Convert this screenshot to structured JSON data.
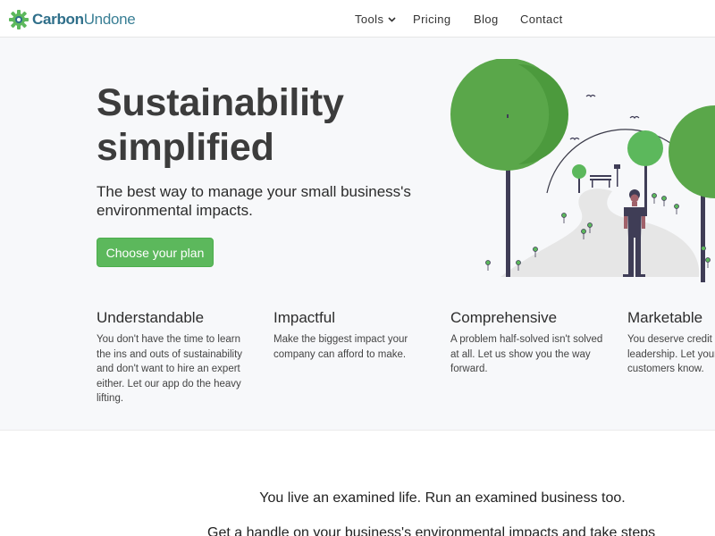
{
  "brand": {
    "name_part1": "Carbon",
    "name_part2": "Undone",
    "logo_icon": "gear-icon",
    "color_primary": "#2f6f8a",
    "color_gear": "#5cb85c"
  },
  "nav": {
    "tools": "Tools",
    "tools_icon": "chevron-down-icon",
    "pricing": "Pricing",
    "blog": "Blog",
    "contact": "Contact"
  },
  "hero": {
    "title_line1": "Sustainability",
    "title_line2": "simplified",
    "subtitle": "The best way to manage your small business's environmental impacts.",
    "cta_label": "Choose your plan",
    "cta_color": "#5cb85c"
  },
  "features": [
    {
      "title": "Understandable",
      "text": "You don't have the time to learn the ins and outs of sustainability and don't want to hire an expert either. Let our app do the heavy lifting."
    },
    {
      "title": "Impactful",
      "text": "Make the biggest impact your company can afford to make."
    },
    {
      "title": "Comprehensive",
      "text": "A problem half-solved isn't solved at all. Let us show you the way forward."
    },
    {
      "title": "Marketable",
      "text": "You deserve credit for your leadership. Let your customers know."
    }
  ],
  "section2": {
    "tagline": "You live an examined life. Run an examined business too.",
    "tagline2": "Get a handle on your business's environmental impacts and take steps"
  }
}
